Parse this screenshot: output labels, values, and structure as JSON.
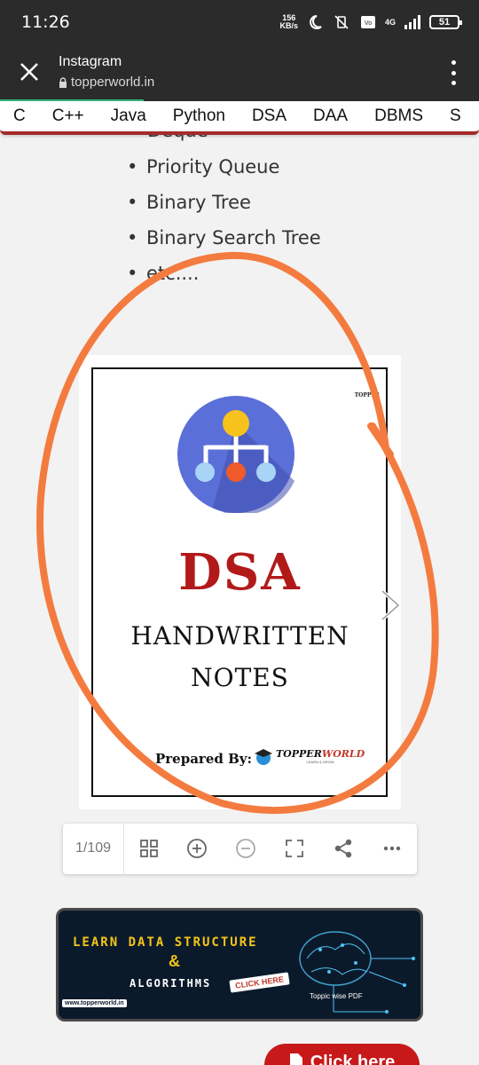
{
  "status_bar": {
    "time": "11:26",
    "speed_value": "156",
    "speed_unit": "KB/s",
    "battery": "51",
    "network": "4G"
  },
  "browser": {
    "title": "Instagram",
    "url": "topperworld.in",
    "load_progress": 0.3
  },
  "nav_tabs": [
    "C",
    "C++",
    "Java",
    "Python",
    "DSA",
    "DAA",
    "DBMS",
    "S"
  ],
  "list": {
    "partial_item": "Deque",
    "items": [
      "Priority Queue",
      "Binary Tree",
      "Binary Search Tree",
      "etc...."
    ]
  },
  "document": {
    "brand_mini": "TOPPER",
    "title": "DSA",
    "subtitle_line1": "HANDWRITTEN",
    "subtitle_line2": "NOTES",
    "prepared_by": "Prepared By:",
    "brand_name_a": "TOPPER",
    "brand_name_b": "WORLD",
    "brand_tagline": "LEARN & GROW"
  },
  "toolbar": {
    "page_indicator": "1/109"
  },
  "banner": {
    "line1": "LEARN DATA STRUCTURE",
    "ampersand": "&",
    "line2": "ALGORITHMS",
    "cta": "CLICK HERE",
    "url": "www.topperworld.in",
    "topic": "Toppic wise PDF"
  },
  "click_button": {
    "label": "Click here"
  },
  "colors": {
    "accent": "#c8191a",
    "progress": "#36b37e",
    "scribble": "#f47b3f",
    "logo_bg": "#5b6fd8"
  }
}
